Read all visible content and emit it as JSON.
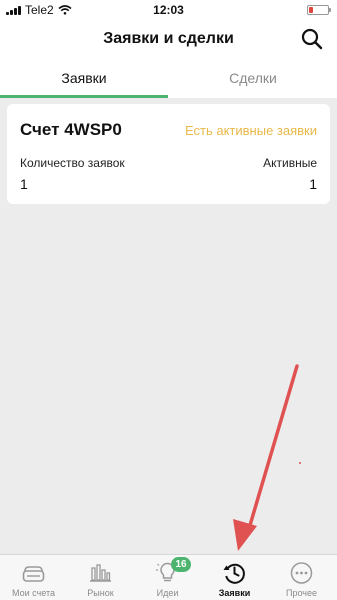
{
  "status_bar": {
    "carrier": "Tele2",
    "time": "12:03"
  },
  "header": {
    "title": "Заявки и сделки"
  },
  "tabs": [
    {
      "label": "Заявки",
      "active": true
    },
    {
      "label": "Сделки",
      "active": false
    }
  ],
  "account_card": {
    "account_name": "Счет 4WSP0",
    "status": "Есть активные заявки",
    "orders_count_label": "Количество заявок",
    "orders_count_value": "1",
    "active_label": "Активные",
    "active_value": "1"
  },
  "tab_bar": {
    "items": [
      {
        "label": "Мои счета",
        "icon": "wallet-icon",
        "active": false
      },
      {
        "label": "Рынок",
        "icon": "market-bars-icon",
        "active": false
      },
      {
        "label": "Идеи",
        "icon": "lightbulb-icon",
        "active": false,
        "badge": "16"
      },
      {
        "label": "Заявки",
        "icon": "history-clock-icon",
        "active": true
      },
      {
        "label": "Прочее",
        "icon": "more-dots-icon",
        "active": false
      }
    ]
  },
  "colors": {
    "accent_green": "#4cb46f",
    "status_yellow": "#e8b94a",
    "arrow_red": "#e05252",
    "background": "#ececec"
  }
}
